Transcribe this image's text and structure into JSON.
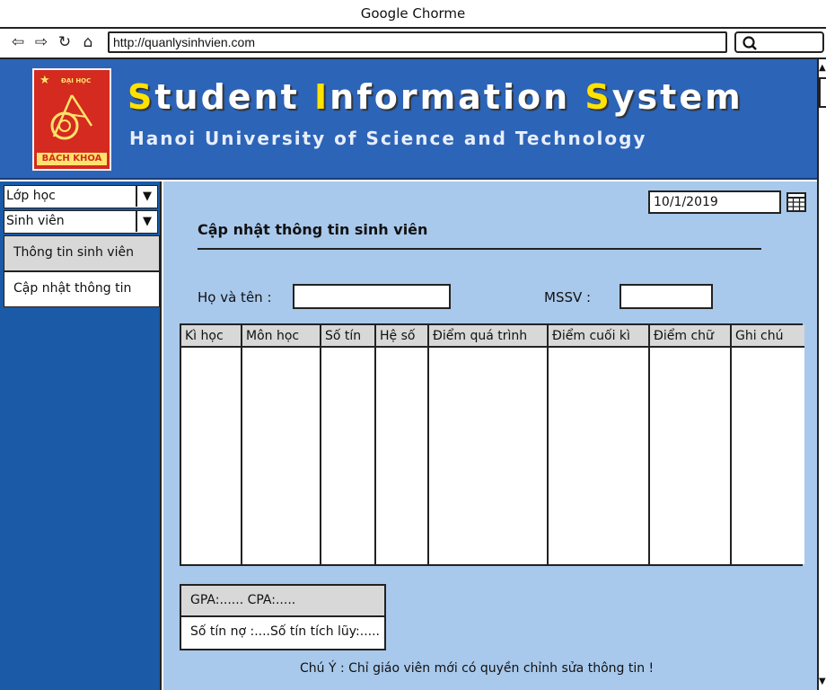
{
  "browser": {
    "window_title": "Google Chorme",
    "url": "http://quanlysinhvien.com",
    "icons": [
      "back-icon",
      "forward-icon",
      "reload-icon",
      "home-icon",
      "search-icon"
    ]
  },
  "banner": {
    "logo_top": "ĐẠI HỌC",
    "logo_bottom": "BÁCH KHOA",
    "title_parts": [
      "S",
      "tudent ",
      "I",
      "nformation ",
      "S",
      "ystem"
    ],
    "subtitle": "Hanoi University of Science and Technology"
  },
  "sidebar": {
    "dropdowns": [
      "Lớp học",
      "Sinh viên"
    ],
    "items": [
      "Thông tin sinh viên",
      "Cập nhật thông tin"
    ]
  },
  "form": {
    "date": "10/1/2019",
    "title": "Cập nhật thông tin sinh viên",
    "name_label": "Họ và tên :",
    "id_label": "MSSV :"
  },
  "table": {
    "columns": [
      "Kì học",
      "Môn học",
      "Số tín",
      "Hệ số",
      "Điểm quá trình",
      "Điểm cuối kì",
      "Điểm chữ",
      "Ghi chú"
    ]
  },
  "summary": {
    "gpa_line": "GPA:...... CPA:.....",
    "credits_line": "Số tín nợ :....Số tín tích lũy:....."
  },
  "note": "Chú Ý : Chỉ giáo viên mới có quyền chỉnh sửa thông tin !",
  "colors": {
    "banner": "#2c64b8",
    "sidebar": "#1a5aa6",
    "content": "#a8c9ec",
    "title_highlight": "#ffe200"
  }
}
